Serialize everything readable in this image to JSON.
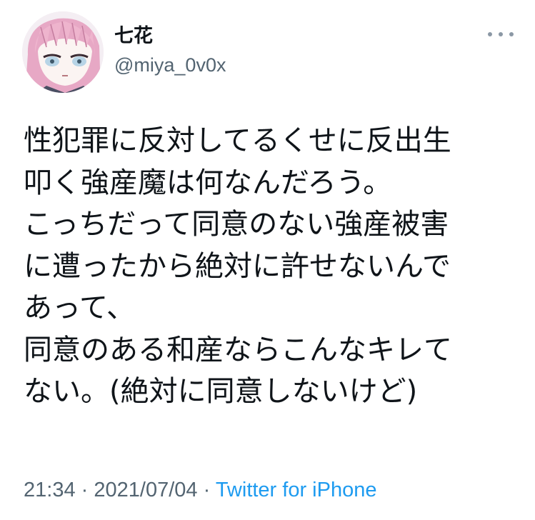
{
  "user": {
    "display_name": "七花",
    "handle": "@miya_0v0x"
  },
  "tweet": {
    "lines": [
      "性犯罪に反対してるくせに反出生",
      "叩く強産魔は何なんだろう。",
      "こっちだって同意のない強産被害",
      "に遭ったから絶対に許せないんで",
      "あって、",
      "同意のある和産ならこんなキレて",
      "ない。(絶対に同意しないけど)"
    ],
    "time": "21:34",
    "separator": "·",
    "date": "2021/07/04",
    "source": "Twitter for iPhone"
  },
  "icons": {
    "more": "more-options-icon",
    "avatar": "anime-girl-avatar"
  },
  "colors": {
    "text": "#0f1419",
    "secondary": "#536471",
    "link": "#1d9bf0",
    "avatar_hair": "#e8a9c4"
  }
}
